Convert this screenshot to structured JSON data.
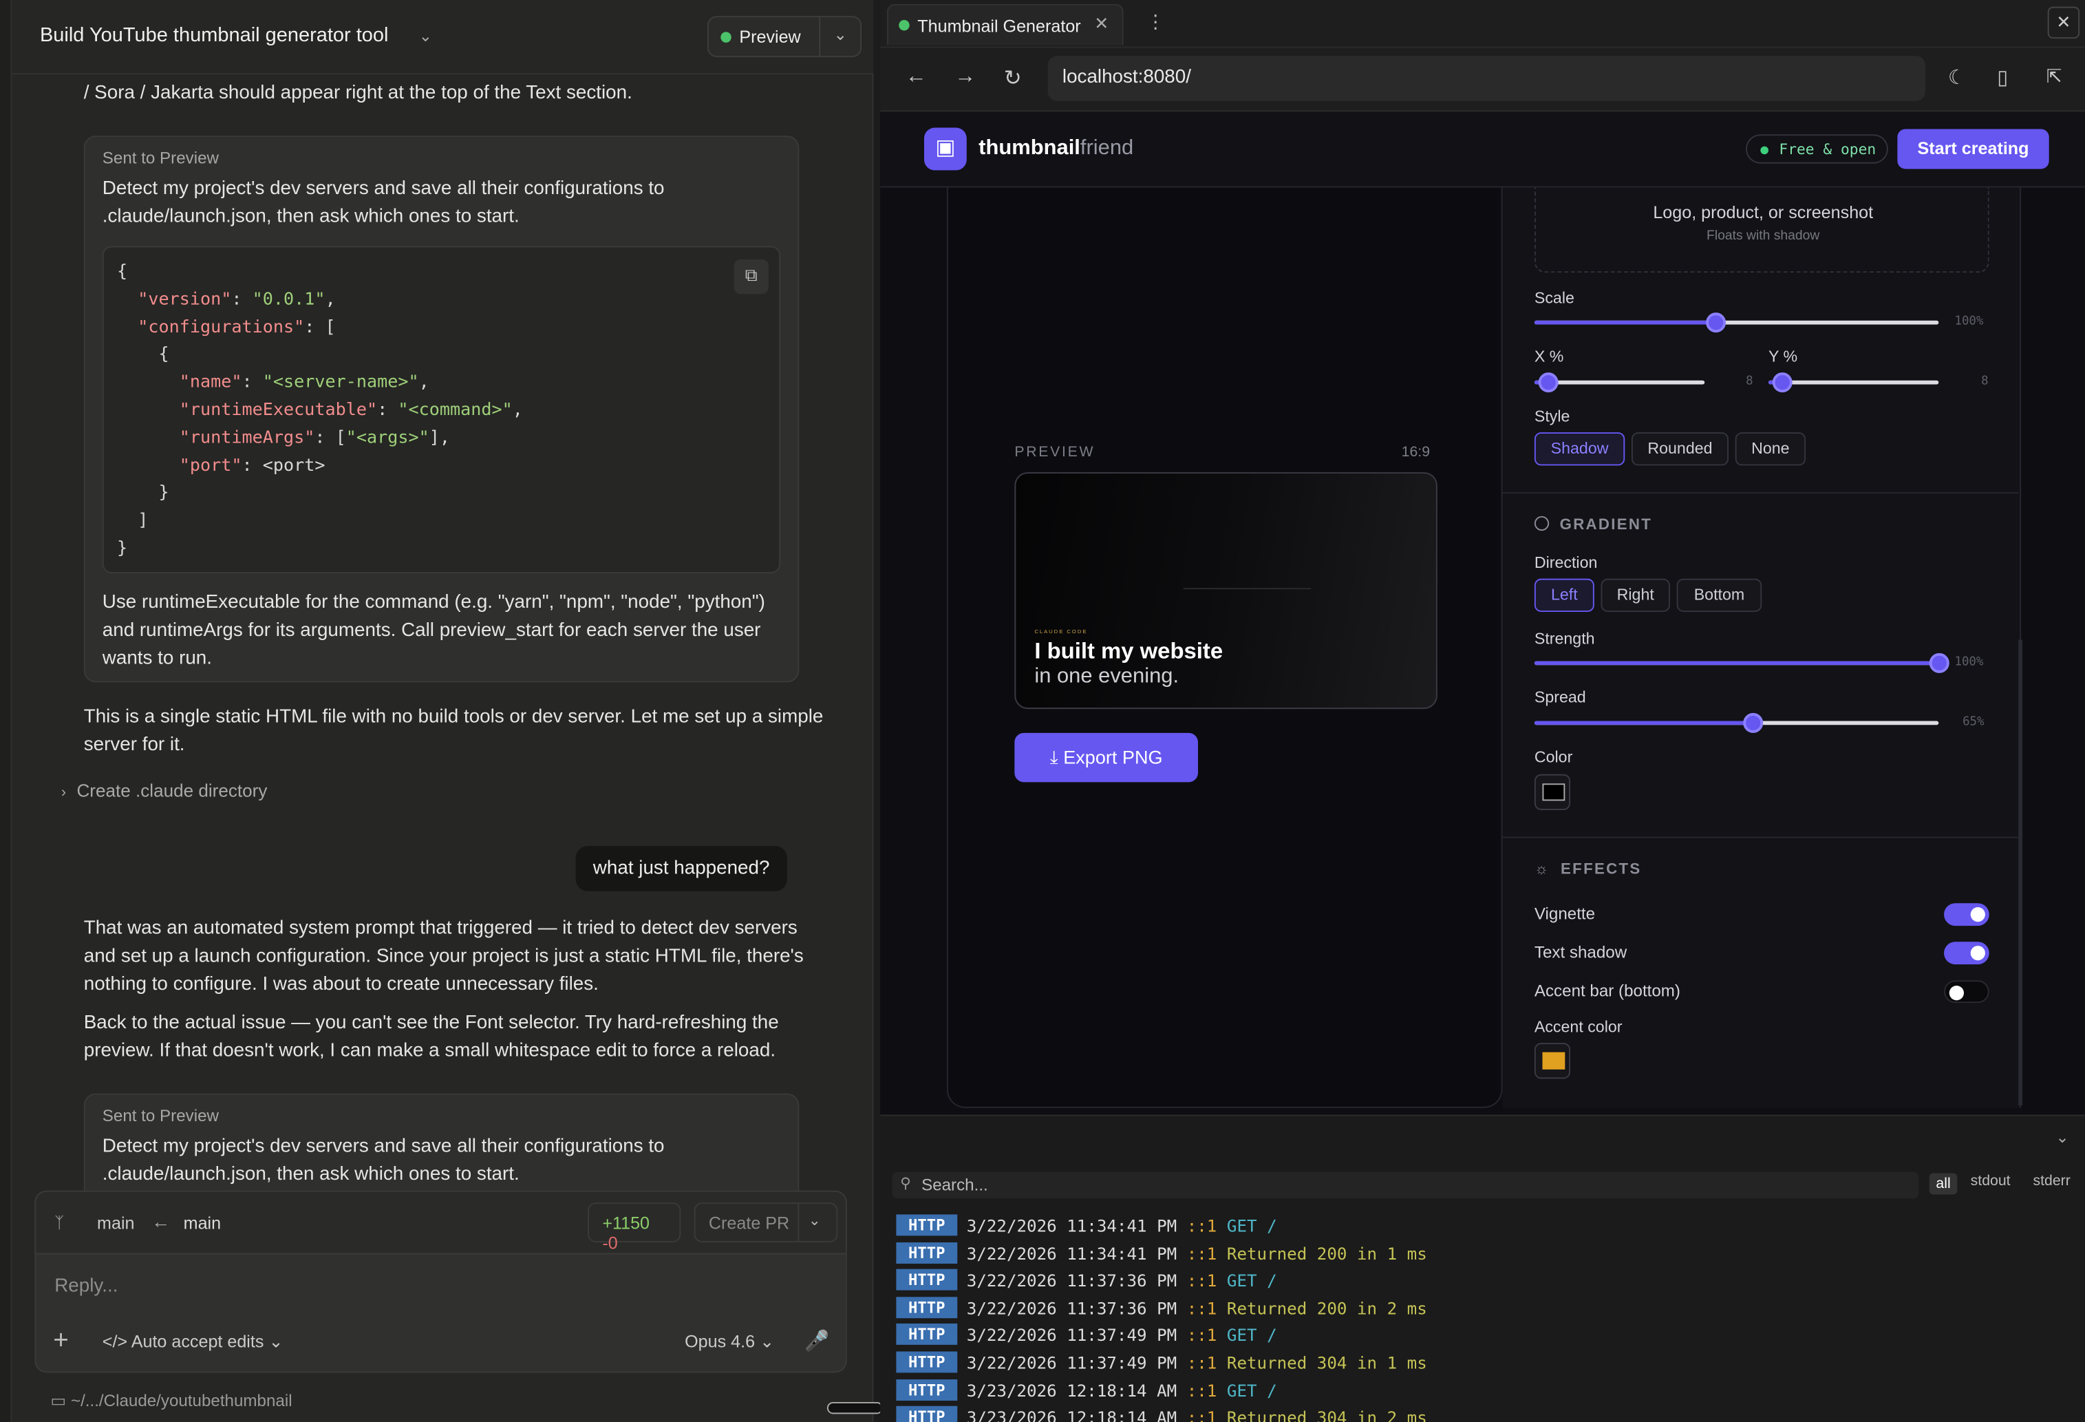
{
  "left": {
    "header": {
      "title": "Build YouTube thumbnail generator tool",
      "preview_label": "Preview"
    },
    "messages": {
      "top_text": "/ Sora / Jakarta should appear right at the top of the Text section.",
      "card1_caption": "Sent to Preview",
      "card1_text": "Detect my project's dev servers and save all their configurations to .claude/launch.json, then ask which ones to start.",
      "code_lines": [
        [
          [
            "p",
            "{"
          ]
        ],
        [
          [
            "p",
            "  "
          ],
          [
            "k",
            "\"version\""
          ],
          [
            "p",
            ": "
          ],
          [
            "s",
            "\"0.0.1\""
          ],
          [
            "p",
            ","
          ]
        ],
        [
          [
            "p",
            "  "
          ],
          [
            "k",
            "\"configurations\""
          ],
          [
            "p",
            ": ["
          ]
        ],
        [
          [
            "p",
            "    {"
          ]
        ],
        [
          [
            "p",
            "      "
          ],
          [
            "k",
            "\"name\""
          ],
          [
            "p",
            ": "
          ],
          [
            "s",
            "\"<server-name>\""
          ],
          [
            "p",
            ","
          ]
        ],
        [
          [
            "p",
            "      "
          ],
          [
            "k",
            "\"runtimeExecutable\""
          ],
          [
            "p",
            ": "
          ],
          [
            "s",
            "\"<command>\""
          ],
          [
            "p",
            ","
          ]
        ],
        [
          [
            "p",
            "      "
          ],
          [
            "k",
            "\"runtimeArgs\""
          ],
          [
            "p",
            ": ["
          ],
          [
            "s",
            "\"<args>\""
          ],
          [
            "p",
            "],"
          ]
        ],
        [
          [
            "p",
            "      "
          ],
          [
            "k",
            "\"port\""
          ],
          [
            "p",
            ": <port>"
          ]
        ],
        [
          [
            "p",
            "    }"
          ]
        ],
        [
          [
            "p",
            "  ]"
          ]
        ],
        [
          [
            "p",
            "}"
          ]
        ]
      ],
      "card1_after": "Use runtimeExecutable for the command (e.g. \"yarn\", \"npm\", \"node\", \"python\") and runtimeArgs for its arguments. Call preview_start for each server the user wants to run.",
      "assistant1": "This is a single static HTML file with no build tools or dev server. Let me set up a simple server for it.",
      "tool_call": "Create .claude directory",
      "user_bubble": "what just happened?",
      "assistant2": "That was an automated system prompt that triggered — it tried to detect dev servers and set up a launch configuration. Since your project is just a static HTML file, there's nothing to configure. I was about to create unnecessary files.",
      "assistant3": "Back to the actual issue — you can't see the Font selector. Try hard-refreshing the preview. If that doesn't work, I can make a small whitespace edit to force a reload.",
      "card2_caption": "Sent to Preview",
      "card2_text": "Detect my project's dev servers and save all their configurations to .claude/launch.json, then ask which ones to start."
    },
    "branch": {
      "from": "main",
      "to": "main",
      "added": "+1150",
      "removed": "-0",
      "create_pr": "Create PR"
    },
    "composer": {
      "placeholder": "Reply...",
      "mode": "Auto accept edits",
      "model": "Opus 4.6"
    },
    "footer_path": "~/.../Claude/youtubethumbnail"
  },
  "browser": {
    "tab_title": "Thumbnail Generator",
    "url": "localhost:8080/",
    "app": {
      "brand_bold": "thumbnail",
      "brand_light": "friend",
      "badge": "Free & open",
      "cta": "Start creating",
      "preview_label": "PREVIEW",
      "ratio": "16:9",
      "thumb_kicker": "CLAUDE CODE",
      "thumb_line1": "I built my website",
      "thumb_line2": "in one evening.",
      "export_label": "Export PNG",
      "image_drop": {
        "title": "Logo, product, or screenshot",
        "hint": "Floats with shadow"
      },
      "scale": {
        "label": "Scale",
        "value": "100%",
        "level": 0.45
      },
      "x_pct": {
        "label": "X %",
        "value": "8",
        "level": 0.08
      },
      "y_pct": {
        "label": "Y %",
        "value": "8",
        "level": 0.08
      },
      "style": {
        "label": "Style",
        "options": [
          "Shadow",
          "Rounded",
          "None"
        ],
        "selected": "Shadow"
      },
      "gradient": {
        "section": "GRADIENT",
        "direction_label": "Direction",
        "directions": [
          "Left",
          "Right",
          "Bottom"
        ],
        "selected": "Left",
        "strength": {
          "label": "Strength",
          "value": "100%",
          "level": 1.0
        },
        "spread": {
          "label": "Spread",
          "value": "65%",
          "level": 0.54
        },
        "color_label": "Color",
        "color": "#000000"
      },
      "effects": {
        "section": "EFFECTS",
        "vignette": {
          "label": "Vignette",
          "on": true
        },
        "text_shadow": {
          "label": "Text shadow",
          "on": true
        },
        "accent_bar": {
          "label": "Accent bar (bottom)",
          "on": false
        },
        "accent_color_label": "Accent color",
        "accent_color": "#e0a020"
      },
      "accent": "#6657f0"
    },
    "console": {
      "search_placeholder": "Search...",
      "filters": [
        "all",
        "stdout",
        "stderr"
      ],
      "rows": [
        {
          "tag": "HTTP",
          "time": "3/22/2026 11:34:41 PM",
          "ip": "::1",
          "text": "GET /",
          "kind": "m"
        },
        {
          "tag": "HTTP",
          "time": "3/22/2026 11:34:41 PM",
          "ip": "::1",
          "text": "Returned 200 in 1 ms",
          "kind": "rt"
        },
        {
          "tag": "HTTP",
          "time": "3/22/2026 11:37:36 PM",
          "ip": "::1",
          "text": "GET /",
          "kind": "m"
        },
        {
          "tag": "HTTP",
          "time": "3/22/2026 11:37:36 PM",
          "ip": "::1",
          "text": "Returned 200 in 2 ms",
          "kind": "rt"
        },
        {
          "tag": "HTTP",
          "time": "3/22/2026 11:37:49 PM",
          "ip": "::1",
          "text": "GET /",
          "kind": "m"
        },
        {
          "tag": "HTTP",
          "time": "3/22/2026 11:37:49 PM",
          "ip": "::1",
          "text": "Returned 304 in 1 ms",
          "kind": "rt"
        },
        {
          "tag": "HTTP",
          "time": "3/23/2026 12:18:14 AM",
          "ip": "::1",
          "text": "GET /",
          "kind": "m"
        },
        {
          "tag": "HTTP",
          "time": "3/23/2026 12:18:14 AM",
          "ip": "::1",
          "text": "Returned 304 in 2 ms",
          "kind": "rt"
        }
      ]
    }
  }
}
